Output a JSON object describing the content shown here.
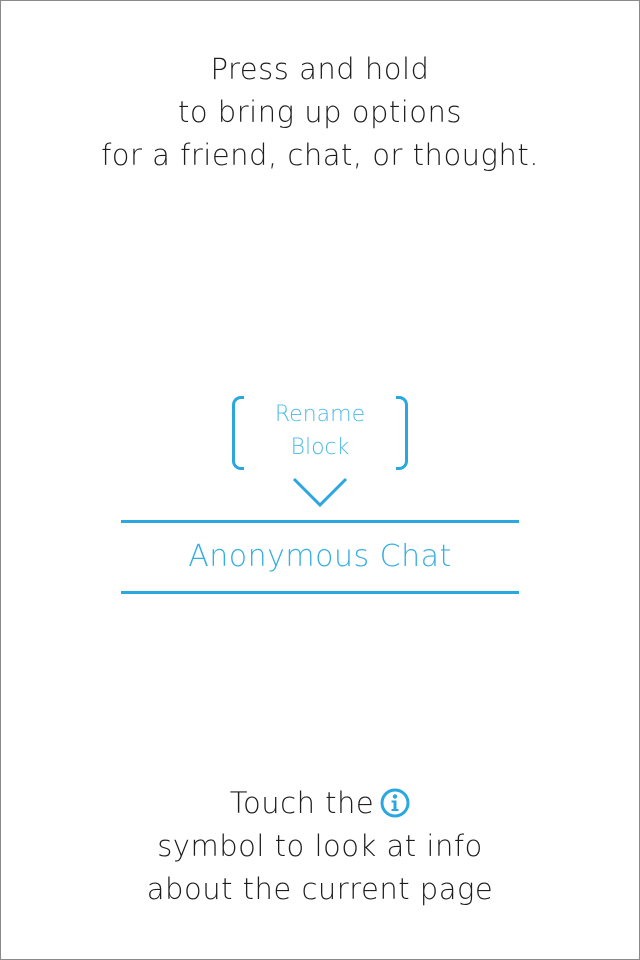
{
  "instructions": {
    "top_lines": [
      "Press and hold",
      "to bring up options",
      "for a friend, chat, or thought."
    ],
    "bottom_line1": "Touch the",
    "bottom_line2": "symbol to look at info",
    "bottom_line3": "about the current page"
  },
  "context_menu": {
    "rename_label": "Rename",
    "block_label": "Block"
  },
  "chat_item": {
    "label": "Anonymous Chat"
  },
  "colors": {
    "accent": "#29a7de",
    "text": "#1d1d1d"
  },
  "icons": {
    "info": "info-icon",
    "pointer": "chevron-down-icon"
  }
}
